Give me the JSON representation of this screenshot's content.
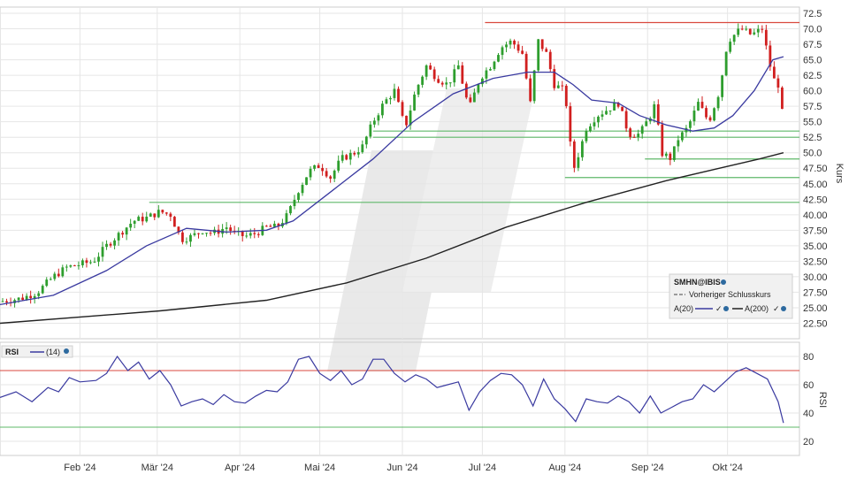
{
  "chart_data": [
    {
      "type": "candlestick",
      "ylabel": "Kurs",
      "ylim": [
        20,
        73.5
      ],
      "yticks": [
        "72.5",
        "70.0",
        "67.5",
        "65.0",
        "62.5",
        "60.0",
        "57.5",
        "55.0",
        "52.5",
        "50.0",
        "47.50",
        "45.00",
        "42.50",
        "40.00",
        "37.50",
        "35.00",
        "32.50",
        "30.00",
        "27.50",
        "25.00",
        "22.50"
      ],
      "yticks_values": [
        72.5,
        70,
        67.5,
        65,
        62.5,
        60,
        57.5,
        55,
        52.5,
        50,
        47.5,
        45,
        42.5,
        40,
        37.5,
        35,
        32.5,
        30,
        27.5,
        25,
        22.5
      ],
      "x_months": [
        "Feb '24",
        "Mär '24",
        "Apr '24",
        "Mai '24",
        "Jun '24",
        "Jul '24",
        "Aug '24",
        "Sep '24",
        "Okt '24"
      ],
      "x_month_days": [
        30,
        59,
        90,
        120,
        151,
        181,
        212,
        243,
        273
      ],
      "day_range": [
        0,
        300
      ],
      "close_series": [
        [
          0,
          26
        ],
        [
          8,
          26.5
        ],
        [
          14,
          27.5
        ],
        [
          20,
          30
        ],
        [
          25,
          31.5
        ],
        [
          30,
          32
        ],
        [
          35,
          32.5
        ],
        [
          40,
          35
        ],
        [
          45,
          37
        ],
        [
          50,
          39
        ],
        [
          55,
          39.5
        ],
        [
          60,
          40.5
        ],
        [
          64,
          40
        ],
        [
          68,
          36
        ],
        [
          72,
          36.5
        ],
        [
          76,
          37.5
        ],
        [
          80,
          37
        ],
        [
          85,
          38
        ],
        [
          88,
          37
        ],
        [
          92,
          36.5
        ],
        [
          96,
          37
        ],
        [
          100,
          38
        ],
        [
          104,
          38
        ],
        [
          108,
          40
        ],
        [
          112,
          44
        ],
        [
          116,
          47
        ],
        [
          120,
          48
        ],
        [
          124,
          46
        ],
        [
          128,
          49
        ],
        [
          133,
          50
        ],
        [
          136,
          51
        ],
        [
          140,
          55
        ],
        [
          144,
          58
        ],
        [
          148,
          60
        ],
        [
          152,
          54
        ],
        [
          156,
          60
        ],
        [
          160,
          64
        ],
        [
          164,
          62
        ],
        [
          168,
          61
        ],
        [
          172,
          64
        ],
        [
          176,
          57
        ],
        [
          180,
          62
        ],
        [
          184,
          64
        ],
        [
          188,
          67
        ],
        [
          192,
          68
        ],
        [
          196,
          66
        ],
        [
          199,
          58
        ],
        [
          202,
          68
        ],
        [
          205,
          66
        ],
        [
          208,
          61
        ],
        [
          212,
          60
        ],
        [
          215,
          47
        ],
        [
          218,
          51
        ],
        [
          220,
          54
        ],
        [
          224,
          56
        ],
        [
          228,
          57
        ],
        [
          232,
          58
        ],
        [
          236,
          53
        ],
        [
          240,
          53
        ],
        [
          244,
          56
        ],
        [
          246,
          58
        ],
        [
          248,
          50
        ],
        [
          252,
          49
        ],
        [
          254,
          52
        ],
        [
          258,
          54
        ],
        [
          262,
          58
        ],
        [
          266,
          55
        ],
        [
          270,
          60
        ],
        [
          273,
          68
        ],
        [
          278,
          70
        ],
        [
          282,
          69
        ],
        [
          286,
          70
        ],
        [
          290,
          62
        ],
        [
          292,
          61
        ],
        [
          294,
          55
        ]
      ],
      "ma20": [
        [
          0,
          25.5
        ],
        [
          20,
          27
        ],
        [
          40,
          31
        ],
        [
          55,
          35
        ],
        [
          70,
          37.8
        ],
        [
          85,
          37.2
        ],
        [
          100,
          37.5
        ],
        [
          110,
          39
        ],
        [
          125,
          44
        ],
        [
          140,
          49
        ],
        [
          155,
          55
        ],
        [
          170,
          59.5
        ],
        [
          185,
          62
        ],
        [
          198,
          63
        ],
        [
          208,
          63
        ],
        [
          215,
          61
        ],
        [
          222,
          58.5
        ],
        [
          232,
          58
        ],
        [
          240,
          56
        ],
        [
          250,
          54.5
        ],
        [
          260,
          53.5
        ],
        [
          268,
          54
        ],
        [
          275,
          56
        ],
        [
          283,
          60
        ],
        [
          290,
          65
        ],
        [
          294,
          65.5
        ]
      ],
      "ma200": [
        [
          0,
          22.5
        ],
        [
          60,
          24.5
        ],
        [
          100,
          26.2
        ],
        [
          130,
          29
        ],
        [
          160,
          33
        ],
        [
          190,
          38
        ],
        [
          220,
          42
        ],
        [
          250,
          45.5
        ],
        [
          270,
          47.5
        ],
        [
          285,
          49
        ],
        [
          294,
          50
        ]
      ],
      "horizontal_lines": [
        {
          "value": 71,
          "start_day": 182,
          "end_day": 300,
          "color": "#d94a3f"
        },
        {
          "value": 53.5,
          "start_day": 140,
          "end_day": 300,
          "color": "#5fb86a"
        },
        {
          "value": 52.5,
          "start_day": 140,
          "end_day": 300,
          "color": "#5fb86a"
        },
        {
          "value": 49,
          "start_day": 242,
          "end_day": 300,
          "color": "#5fb86a"
        },
        {
          "value": 46,
          "start_day": 212,
          "end_day": 300,
          "color": "#5fb86a"
        },
        {
          "value": 42,
          "start_day": 56,
          "end_day": 300,
          "color": "#5fb86a"
        }
      ],
      "colors": {
        "up": "#2e9e2e",
        "down": "#d11f1f",
        "ma20": "#3a3aa0",
        "ma200": "#222222",
        "grid": "#e6e6e6"
      }
    },
    {
      "type": "line",
      "name": "RSI",
      "ylabel": "RSI",
      "ylim": [
        10,
        90
      ],
      "yticks": [
        "80",
        "60",
        "40",
        "20"
      ],
      "yticks_values": [
        80,
        60,
        40,
        20
      ],
      "upper_band": 70,
      "lower_band": 30,
      "series": [
        {
          "name": "(14)",
          "values": [
            [
              0,
              51
            ],
            [
              6,
              55
            ],
            [
              12,
              48
            ],
            [
              18,
              58
            ],
            [
              22,
              55
            ],
            [
              26,
              65
            ],
            [
              30,
              62
            ],
            [
              36,
              63
            ],
            [
              40,
              68
            ],
            [
              44,
              80
            ],
            [
              48,
              70
            ],
            [
              52,
              76
            ],
            [
              56,
              64
            ],
            [
              60,
              70
            ],
            [
              64,
              60
            ],
            [
              68,
              45
            ],
            [
              72,
              48
            ],
            [
              76,
              50
            ],
            [
              80,
              46
            ],
            [
              84,
              53
            ],
            [
              88,
              48
            ],
            [
              92,
              47
            ],
            [
              96,
              52
            ],
            [
              100,
              56
            ],
            [
              104,
              55
            ],
            [
              108,
              62
            ],
            [
              112,
              78
            ],
            [
              116,
              80
            ],
            [
              120,
              68
            ],
            [
              124,
              63
            ],
            [
              128,
              70
            ],
            [
              132,
              60
            ],
            [
              136,
              64
            ],
            [
              140,
              78
            ],
            [
              144,
              78
            ],
            [
              148,
              68
            ],
            [
              152,
              62
            ],
            [
              156,
              67
            ],
            [
              160,
              64
            ],
            [
              164,
              58
            ],
            [
              168,
              60
            ],
            [
              172,
              62
            ],
            [
              176,
              42
            ],
            [
              180,
              55
            ],
            [
              184,
              63
            ],
            [
              188,
              68
            ],
            [
              192,
              67
            ],
            [
              196,
              60
            ],
            [
              200,
              45
            ],
            [
              204,
              64
            ],
            [
              208,
              50
            ],
            [
              212,
              43
            ],
            [
              216,
              34
            ],
            [
              220,
              50
            ],
            [
              224,
              48
            ],
            [
              228,
              47
            ],
            [
              232,
              52
            ],
            [
              236,
              48
            ],
            [
              240,
              40
            ],
            [
              244,
              52
            ],
            [
              248,
              40
            ],
            [
              252,
              44
            ],
            [
              256,
              48
            ],
            [
              260,
              50
            ],
            [
              264,
              60
            ],
            [
              268,
              55
            ],
            [
              272,
              62
            ],
            [
              276,
              69
            ],
            [
              280,
              72
            ],
            [
              284,
              68
            ],
            [
              288,
              64
            ],
            [
              292,
              48
            ],
            [
              294,
              33
            ]
          ]
        }
      ],
      "color": "#3a3aa0"
    }
  ],
  "legend": {
    "symbol": "SMHN@IBIS",
    "prev_close": "Vorheriger Schlusskurs",
    "ma20": "A(20)",
    "ma200": "A(200)"
  },
  "rsi_legend": {
    "name": "RSI",
    "period": "(14)"
  }
}
